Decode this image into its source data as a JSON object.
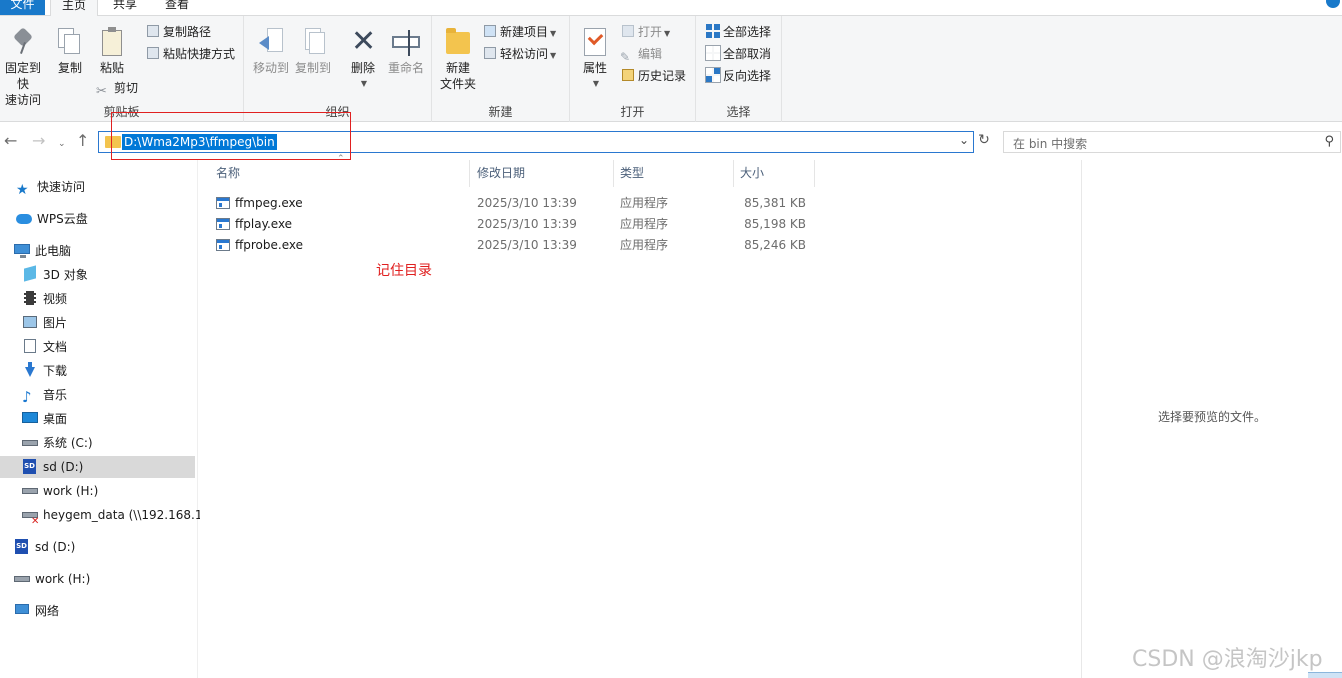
{
  "ribbon": {
    "tabs": [
      "文件",
      "主页",
      "共享",
      "查看"
    ],
    "clipboard": {
      "pin_label_1": "固定到快",
      "pin_label_2": "速访问",
      "copy": "复制",
      "paste": "粘贴",
      "copy_path": "复制路径",
      "paste_shortcut": "粘贴快捷方式",
      "cut": "剪切",
      "group": "剪贴板"
    },
    "organize": {
      "move_to": "移动到",
      "copy_to": "复制到",
      "delete": "删除",
      "rename": "重命名",
      "group": "组织"
    },
    "new": {
      "new_folder_1": "新建",
      "new_folder_2": "文件夹",
      "new_item": "新建项目",
      "easy_access": "轻松访问",
      "group": "新建"
    },
    "open": {
      "properties": "属性",
      "open": "打开",
      "edit": "编辑",
      "history": "历史记录",
      "group": "打开"
    },
    "select": {
      "select_all": "全部选择",
      "select_none": "全部取消",
      "invert": "反向选择",
      "group": "选择"
    }
  },
  "address": {
    "path": "D:\\Wma2Mp3\\ffmpeg\\bin",
    "search_placeholder": "在 bin 中搜索"
  },
  "nav": {
    "quick_access": "快速访问",
    "wps_cloud": "WPS云盘",
    "this_pc": "此电脑",
    "objects3d": "3D 对象",
    "videos": "视频",
    "pictures": "图片",
    "documents": "文档",
    "downloads": "下载",
    "music": "音乐",
    "desktop": "桌面",
    "drive_c": "系统 (C:)",
    "drive_d": "sd (D:)",
    "drive_h": "work (H:)",
    "net_drive": "heygem_data (\\\\192.168.1",
    "drive_d2": "sd (D:)",
    "drive_h2": "work (H:)",
    "network": "网络"
  },
  "filelist": {
    "columns": [
      "名称",
      "修改日期",
      "类型",
      "大小"
    ],
    "rows": [
      {
        "name": "ffmpeg.exe",
        "date": "2025/3/10 13:39",
        "type": "应用程序",
        "size": "85,381 KB"
      },
      {
        "name": "ffplay.exe",
        "date": "2025/3/10 13:39",
        "type": "应用程序",
        "size": "85,198 KB"
      },
      {
        "name": "ffprobe.exe",
        "date": "2025/3/10 13:39",
        "type": "应用程序",
        "size": "85,246 KB"
      }
    ],
    "annotation": "记住目录"
  },
  "preview": {
    "empty_text": "选择要预览的文件。"
  },
  "watermark": "CSDN @浪淘沙jkp",
  "colors": {
    "accent": "#1979ca",
    "annotation_red": "#e02020",
    "selection": "#0078d7"
  }
}
